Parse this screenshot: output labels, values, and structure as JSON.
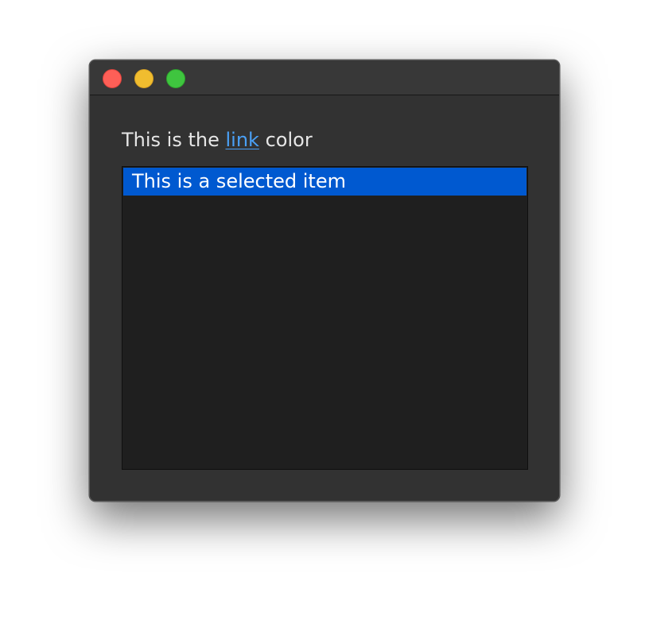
{
  "window": {
    "controls": [
      {
        "name": "close",
        "color": "#fe5f57"
      },
      {
        "name": "minimize",
        "color": "#f0bd2f"
      },
      {
        "name": "zoom",
        "color": "#3fc53f"
      }
    ]
  },
  "text_line": {
    "before": "This is the ",
    "link": "link",
    "after": " color"
  },
  "list": {
    "items": [
      {
        "label": "This is a selected item",
        "selected": true
      }
    ]
  },
  "colors": {
    "window_bg": "#323232",
    "list_bg": "#1f1f1f",
    "selection": "#0059d0",
    "link": "#4aa0f6"
  }
}
